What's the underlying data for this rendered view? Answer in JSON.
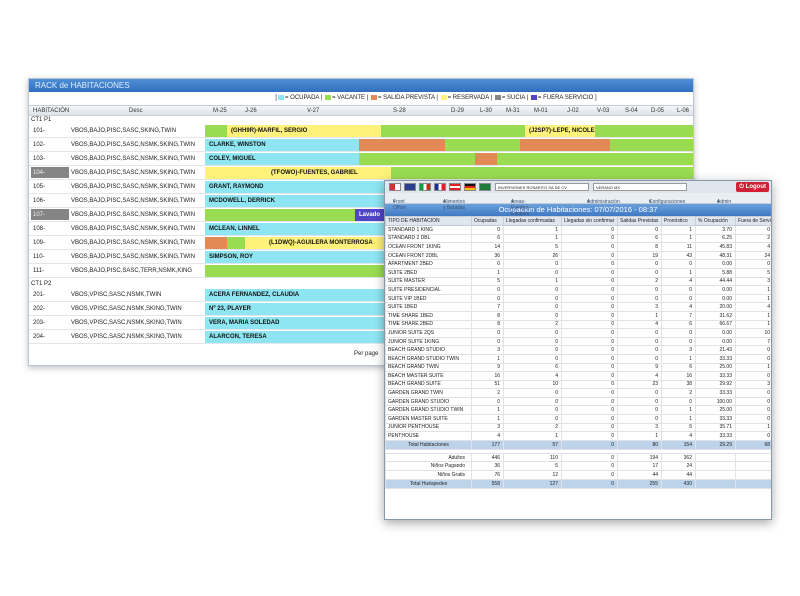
{
  "rack": {
    "title": "RACK de HABITACIONES",
    "legend": [
      {
        "text": "= OCUPADA",
        "color": "#8ee6f2"
      },
      {
        "text": "= VACANTE",
        "color": "#99dc52"
      },
      {
        "text": "= SALIDA PREVISTA",
        "color": "#e28a55"
      },
      {
        "text": "= RESERVADA",
        "color": "#fff27a"
      },
      {
        "text": "= SUCIA",
        "color": "#858585"
      },
      {
        "text": "= FUERA SERVICIO",
        "color": "#4f45c8"
      }
    ],
    "header": {
      "habitacion": "HABITACIÓN",
      "desc": "Desc"
    },
    "days": [
      "M-25",
      "J-26",
      "V-27",
      "S-28",
      "D-29",
      "L-30",
      "M-31",
      "M-01",
      "J-02",
      "V-03",
      "S-04",
      "D-05",
      "L-06"
    ],
    "group1": "CT1 P1",
    "group2": "CT1 P2",
    "rooms": [
      {
        "room": "101-",
        "desc": "VBOS,BAJO,PISC,SASC,SKING,TWIN",
        "dark": false
      },
      {
        "room": "102-",
        "desc": "VBOS,BAJO,PISC,SASC,NSMK,SKING,TWIN",
        "dark": false
      },
      {
        "room": "103-",
        "desc": "VBOS,BAJO,PISC,SASC,NSMK,SKING,TWIN",
        "dark": false
      },
      {
        "room": "104-",
        "desc": "VBOS,BAJO,PISC,SASC,NSMK,SKING,TWIN",
        "dark": true
      },
      {
        "room": "105-",
        "desc": "VBOS,BAJO,PISC,SASC,NSMK,SKING,TWIN",
        "dark": false
      },
      {
        "room": "106-",
        "desc": "VBOS,BAJO,PISC,SASC,NSMK,SKING,TWIN",
        "dark": false
      },
      {
        "room": "107-",
        "desc": "VBOS,BAJO,PISC,SASC,NSMK,SKING,TWIN",
        "dark": true
      },
      {
        "room": "108-",
        "desc": "VBOS,BAJO,PISC,SASC,NSMK,SKING,TWIN",
        "dark": false
      },
      {
        "room": "109-",
        "desc": "VBOS,BAJO,PISC,SASC,NSMK,SKING,TWIN",
        "dark": false
      },
      {
        "room": "110-",
        "desc": "VBOS,BAJO,PISC,SASC,NSMK,SKING,TWIN",
        "dark": false
      },
      {
        "room": "111-",
        "desc": "VBOS,BAJO,PISC,SASC,TERR,NSMK,KING",
        "dark": false
      },
      {
        "room": "201-",
        "desc": "VBOS,VPISC,SASC,NSMK,TWIN",
        "dark": false
      },
      {
        "room": "202-",
        "desc": "VBOS,VPISC,SASC,NSMK,SKING,TWIN",
        "dark": false
      },
      {
        "room": "203-",
        "desc": "VBOS,VPISC,SASC,NSMK,SKING,TWIN",
        "dark": false
      },
      {
        "room": "204-",
        "desc": "VBOS,VPISC,SASC,NSMK,SKING,TWIN",
        "dark": false
      }
    ],
    "guests": [
      "(GHH9R)-MARFIL, SERGIO",
      "(J2SP7)-LEPE, NICOLE",
      "CLARKE, WINSTON",
      "COLEY, MIGUEL",
      "(TFOWO)-FUENTES, GABRIEL",
      "GRANT, RAYMOND",
      "MCDOWELL, DERRICK",
      "Lavado",
      "MCLEAN, LINNEL",
      "(L1DWQ)-AGUILERA MONTERROSA",
      "SIMPSON, ROY",
      "ACERA FERNANDEZ, CLAUDIA",
      "Nº 23, PLAYER",
      "VERA, MARIA SOLEDAD",
      "ALARCON, TERESA"
    ],
    "pager": "Per page"
  },
  "occ": {
    "company": "INVERSIONES ROSARITO SA DE CV",
    "hotel": "VERANO MX",
    "logout": "Logout",
    "menu": [
      "Front Office",
      "Alimentos y Bebidas",
      "Areas-Eventos-Equipos",
      "Administración",
      "Configuraciones",
      "Admin"
    ],
    "title": "Ocupación de Habitaciones: 07/07/2016 - 08:37",
    "columns": [
      "TIPO DE HABITACION",
      "Ocupadas",
      "Llegadas confirmadas",
      "Llegadas sin confirmar",
      "Salidas Previstas",
      "Pronóstico",
      "% Ocupación",
      "Fuera de Servicio"
    ],
    "rows": [
      [
        "STANDARD 1 KING",
        "0",
        "1",
        "0",
        "0",
        "1",
        "3.70",
        "0"
      ],
      [
        "STANDARD 2 DBL",
        "6",
        "1",
        "0",
        "6",
        "1",
        "6.25",
        "2"
      ],
      [
        "OCEAN FRONT 1KING",
        "14",
        "5",
        "0",
        "8",
        "11",
        "45.83",
        "4"
      ],
      [
        "OCEAN FRONT 2DBL",
        "36",
        "26",
        "0",
        "19",
        "43",
        "48.31",
        "24"
      ],
      [
        "APARTMENT 2BED",
        "0",
        "0",
        "0",
        "0",
        "0",
        "0.00",
        "0"
      ],
      [
        "SUITE 2BED",
        "1",
        "0",
        "0",
        "0",
        "1",
        "5.88",
        "5"
      ],
      [
        "SUITE MASTER",
        "5",
        "1",
        "0",
        "2",
        "4",
        "44.44",
        "3"
      ],
      [
        "SUITE PRESIDENCIAL",
        "0",
        "0",
        "0",
        "0",
        "0",
        "0.00",
        "1"
      ],
      [
        "SUITE VIP 1BED",
        "0",
        "0",
        "0",
        "0",
        "0",
        "0.00",
        "1"
      ],
      [
        "SUITE 1BED",
        "7",
        "0",
        "0",
        "3",
        "4",
        "20.00",
        "4"
      ],
      [
        "TIME SHARE 1BED",
        "8",
        "0",
        "0",
        "1",
        "7",
        "31.62",
        "1"
      ],
      [
        "TIME SHARE 2BED",
        "8",
        "2",
        "0",
        "4",
        "6",
        "66.67",
        "1"
      ],
      [
        "JUNIOR SUITE 2QS",
        "0",
        "0",
        "0",
        "0",
        "0",
        "0.00",
        "10"
      ],
      [
        "JUNIOR SUITE 1KING",
        "0",
        "0",
        "0",
        "0",
        "0",
        "0.00",
        "7"
      ],
      [
        "BEACH GRAND STUDIO",
        "3",
        "0",
        "0",
        "0",
        "3",
        "21.43",
        "0"
      ],
      [
        "BEACH GRAND STUDIO TWIN",
        "1",
        "0",
        "0",
        "0",
        "1",
        "33.33",
        "0"
      ],
      [
        "BEACH GRAND TWIN",
        "9",
        "6",
        "0",
        "9",
        "6",
        "25.00",
        "1"
      ],
      [
        "BEACH MASTER SUITE",
        "16",
        "4",
        "0",
        "4",
        "16",
        "33.33",
        "0"
      ],
      [
        "BEACH GRAND SUITE",
        "51",
        "10",
        "0",
        "23",
        "38",
        "29.92",
        "3"
      ],
      [
        "GARDEN GRAND TWIN",
        "2",
        "0",
        "0",
        "0",
        "2",
        "33.33",
        "0"
      ],
      [
        "GARDEN GRAND STUDIO",
        "0",
        "0",
        "0",
        "0",
        "0",
        "100.00",
        "0"
      ],
      [
        "GARDEN GRAND STUDIO TWIN",
        "1",
        "0",
        "0",
        "0",
        "1",
        "25.00",
        "0"
      ],
      [
        "GARDEN MASTER SUITE",
        "1",
        "0",
        "0",
        "0",
        "1",
        "33.33",
        "0"
      ],
      [
        "JUNIOR PENTHOUSE",
        "3",
        "2",
        "0",
        "3",
        "5",
        "35.71",
        "1"
      ],
      [
        "PENTHOUSE",
        "4",
        "1",
        "0",
        "1",
        "4",
        "33.33",
        "0"
      ]
    ],
    "total_hab": [
      "Total Habitaciones",
      "177",
      "57",
      "0",
      "80",
      "154",
      "29.29",
      "68"
    ],
    "adultos": [
      "Adultos",
      "446",
      "110",
      "0",
      "194",
      "362"
    ],
    "ninos_pagando": [
      "Niños Pagando",
      "36",
      "5",
      "0",
      "17",
      "24"
    ],
    "ninos_gratis": [
      "Niños Gratis",
      "76",
      "12",
      "0",
      "44",
      "44"
    ],
    "total_hues": [
      "Total Huéspedes",
      "558",
      "127",
      "0",
      "255",
      "430"
    ]
  }
}
